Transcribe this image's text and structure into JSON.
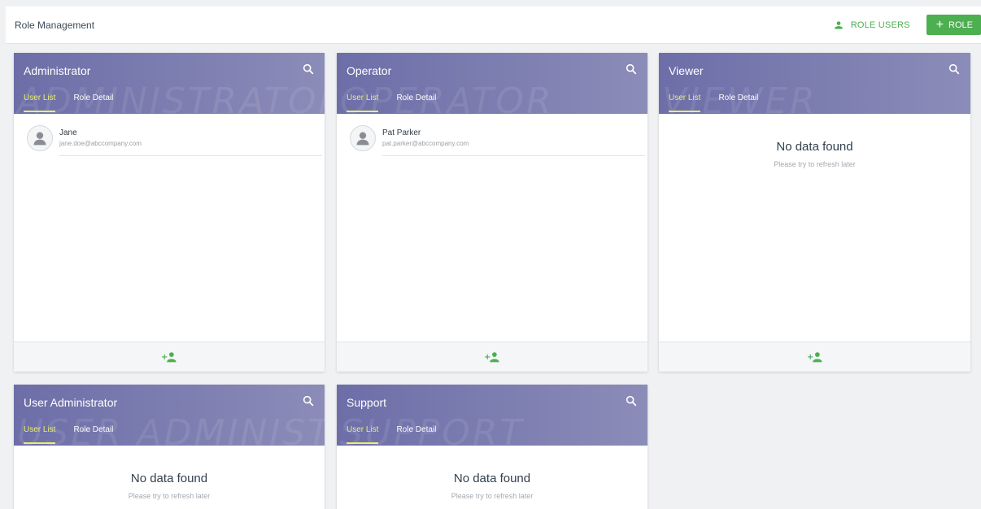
{
  "header": {
    "title": "Role Management",
    "role_users_label": "ROLE USERS",
    "add_role_label": "ROLE"
  },
  "colors": {
    "accent_green": "#4caf50",
    "card_header": "#7778ad",
    "active_tab": "#e9f06a"
  },
  "icons": {
    "search": "search-icon",
    "add_user": "person-add-icon",
    "avatar": "avatar-placeholder-icon",
    "role_users": "person-icon",
    "add_role": "plus-icon"
  },
  "tabs": {
    "user_list": "User List",
    "role_detail": "Role Detail"
  },
  "empty_state": {
    "title": "No data found",
    "subtitle": "Please try to refresh later"
  },
  "roles": [
    {
      "name": "Administrator",
      "watermark": "ADMINISTRATOR",
      "users": [
        {
          "name": "Jane",
          "email": "jane.doe@abccompany.com"
        }
      ]
    },
    {
      "name": "Operator",
      "watermark": "OPERATOR",
      "users": [
        {
          "name": "Pat Parker",
          "email": "pat.parker@abccompany.com"
        }
      ]
    },
    {
      "name": "Viewer",
      "watermark": "VIEWER",
      "users": []
    },
    {
      "name": "User Administrator",
      "watermark": "USER ADMINISTRATOR",
      "users": []
    },
    {
      "name": "Support",
      "watermark": "SUPPORT",
      "users": []
    }
  ]
}
